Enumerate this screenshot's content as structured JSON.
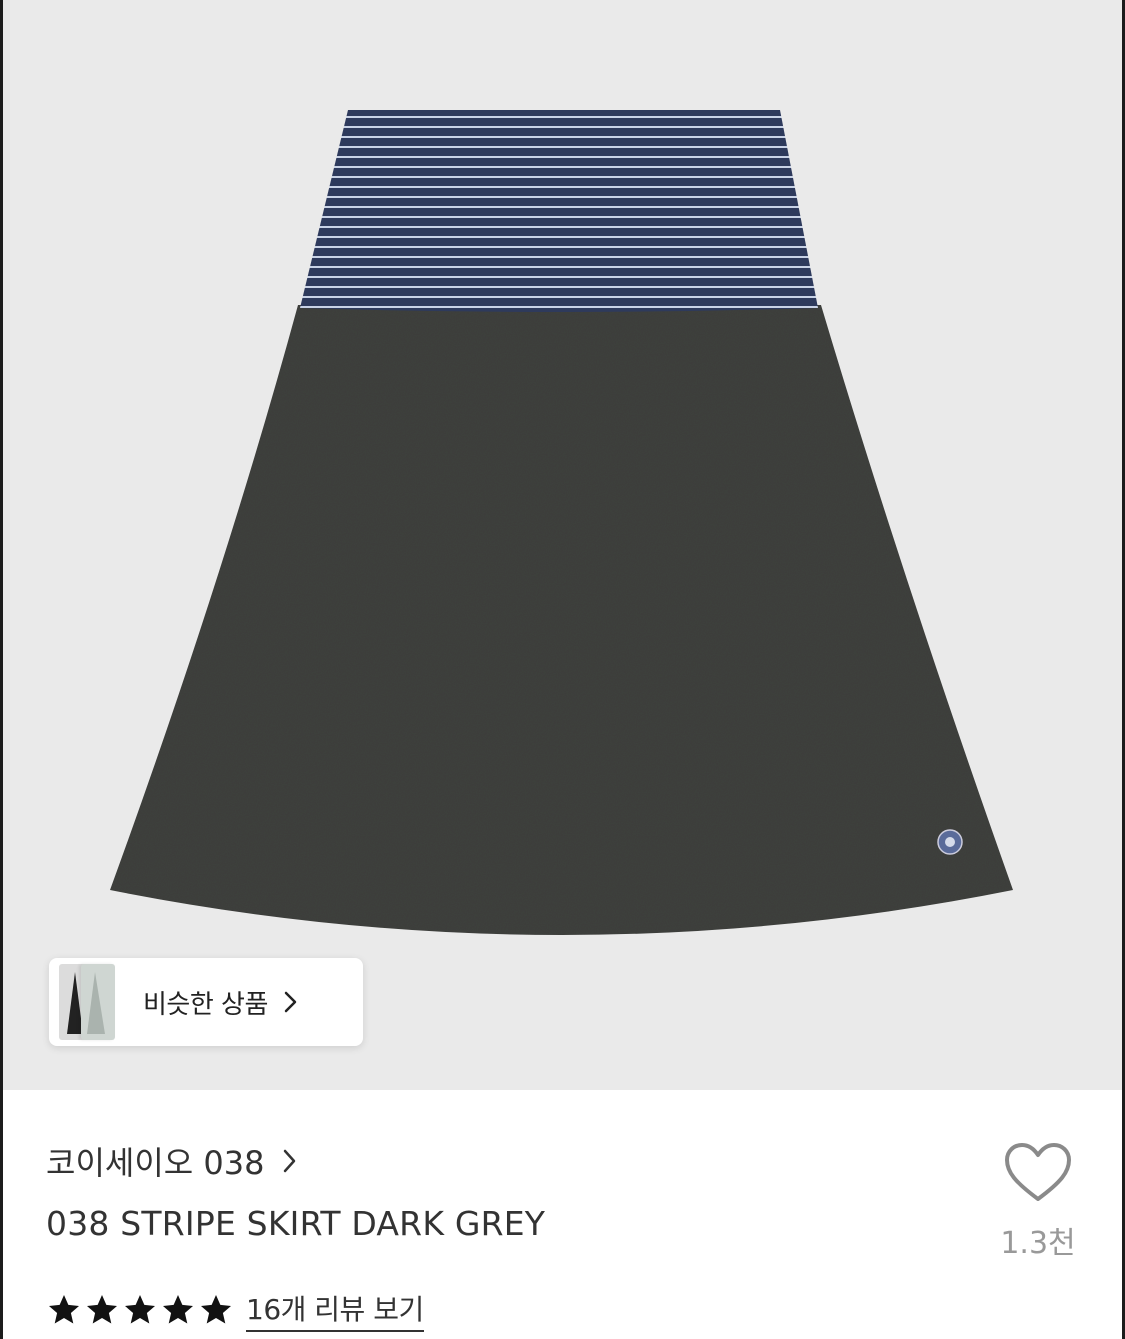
{
  "similar": {
    "label": "비슷한 상품"
  },
  "product": {
    "brand": "코이세이오 038",
    "name": "038 STRIPE SKIRT DARK GREY",
    "rating_stars": 5,
    "review_link": "16개 리뷰 보기",
    "likes": "1.3천"
  },
  "colors": {
    "background": "#eaeaea",
    "skirt": "#3f403d",
    "waistband": "#2e3a5c",
    "stripe": "#c8d2e6"
  }
}
